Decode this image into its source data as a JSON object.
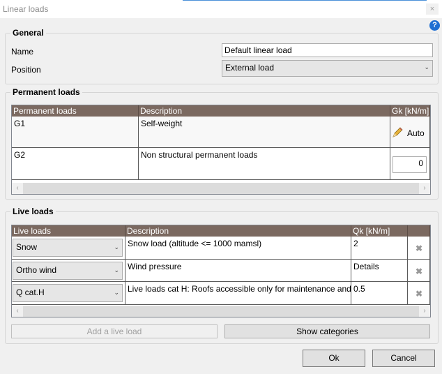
{
  "window": {
    "title": "Linear loads",
    "close_glyph": "×",
    "help_glyph": "?"
  },
  "general": {
    "title": "General",
    "name_label": "Name",
    "name_value": "Default linear load",
    "position_label": "Position",
    "position_value": "External load"
  },
  "permanent": {
    "title": "Permanent loads",
    "headers": [
      "Permanent loads",
      "Description",
      "Gk [kN/m]"
    ],
    "rows": [
      {
        "name": "G1",
        "description": "Self-weight",
        "value": "Auto"
      },
      {
        "name": "G2",
        "description": "Non structural permanent loads",
        "value": "0"
      }
    ]
  },
  "live": {
    "title": "Live loads",
    "headers": [
      "Live loads",
      "Description",
      "Qk [kN/m]",
      ""
    ],
    "rows": [
      {
        "name": "Snow",
        "description": "Snow load (altitude <= 1000 mamsl)",
        "value": "2"
      },
      {
        "name": "Ortho wind",
        "description": "Wind pressure",
        "value": "Details"
      },
      {
        "name": "Q cat.H",
        "description": "Live loads cat H: Roofs accessible only for maintenance and",
        "value": "0.5"
      }
    ],
    "add_button": "Add a live load",
    "categories_button": "Show categories"
  },
  "footer": {
    "ok": "Ok",
    "cancel": "Cancel"
  },
  "colors": {
    "header_bg": "#7b6960",
    "help_icon": "#1f6fd2",
    "dialog_bg": "#f0f0f0"
  }
}
